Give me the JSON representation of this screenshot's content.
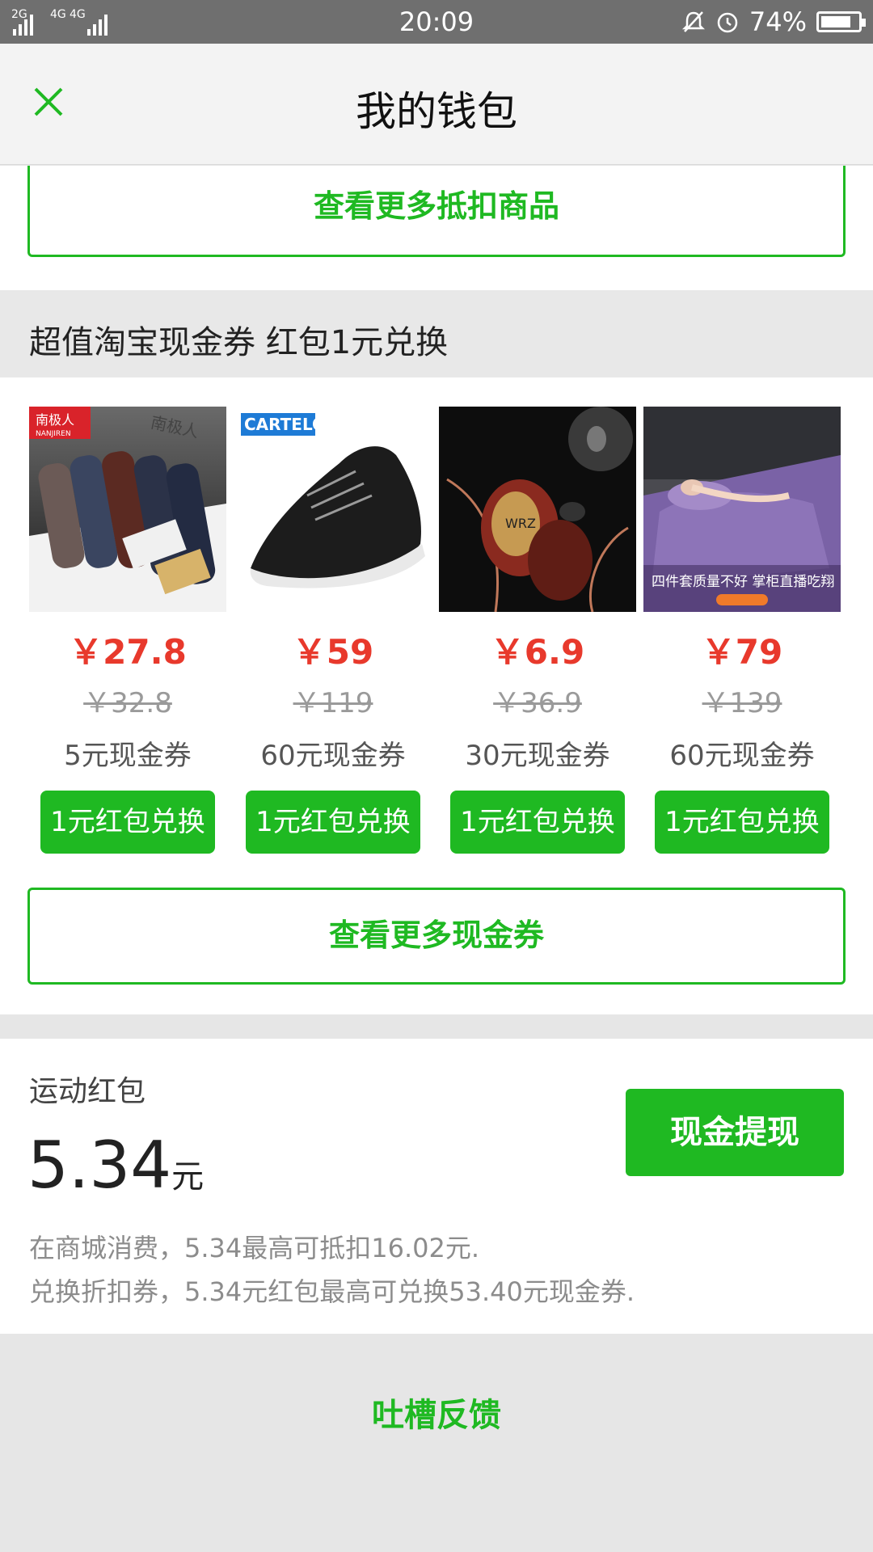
{
  "status_bar": {
    "network_1": "2G",
    "network_2": "4G",
    "network_3": "4G",
    "time": "20:09",
    "battery": "74%",
    "icons": [
      "bell-off-icon",
      "alarm-icon",
      "battery-icon"
    ]
  },
  "nav": {
    "title": "我的钱包",
    "close_icon": "close-icon"
  },
  "more_deduct_label": "查看更多抵扣商品",
  "section_title": "超值淘宝现金券 红包1元兑换",
  "products": [
    {
      "price": "￥27.8",
      "original": "￥32.8",
      "coupon": "5元现金券",
      "button": "1元红包兑换",
      "image_brand": "南极人"
    },
    {
      "price": "￥59",
      "original": "￥119",
      "coupon": "60元现金券",
      "button": "1元红包兑换",
      "image_brand": "CARTELO"
    },
    {
      "price": "￥6.9",
      "original": "￥36.9",
      "coupon": "30元现金券",
      "button": "1元红包兑换",
      "image_brand": ""
    },
    {
      "price": "￥79",
      "original": "￥139",
      "coupon": "60元现金券",
      "button": "1元红包兑换",
      "image_brand": ""
    }
  ],
  "more_coupons_label": "查看更多现金券",
  "wallet": {
    "title": "运动红包",
    "amount": "5.34",
    "unit": "元",
    "withdraw_label": "现金提现",
    "info_1": "在商城消费，5.34最高可抵扣16.02元.",
    "info_2": "兑换折扣券，5.34元红包最高可兑换53.40元现金券."
  },
  "feedback_label": "吐槽反馈",
  "colors": {
    "accent": "#1fb922",
    "price": "#e8392c"
  }
}
